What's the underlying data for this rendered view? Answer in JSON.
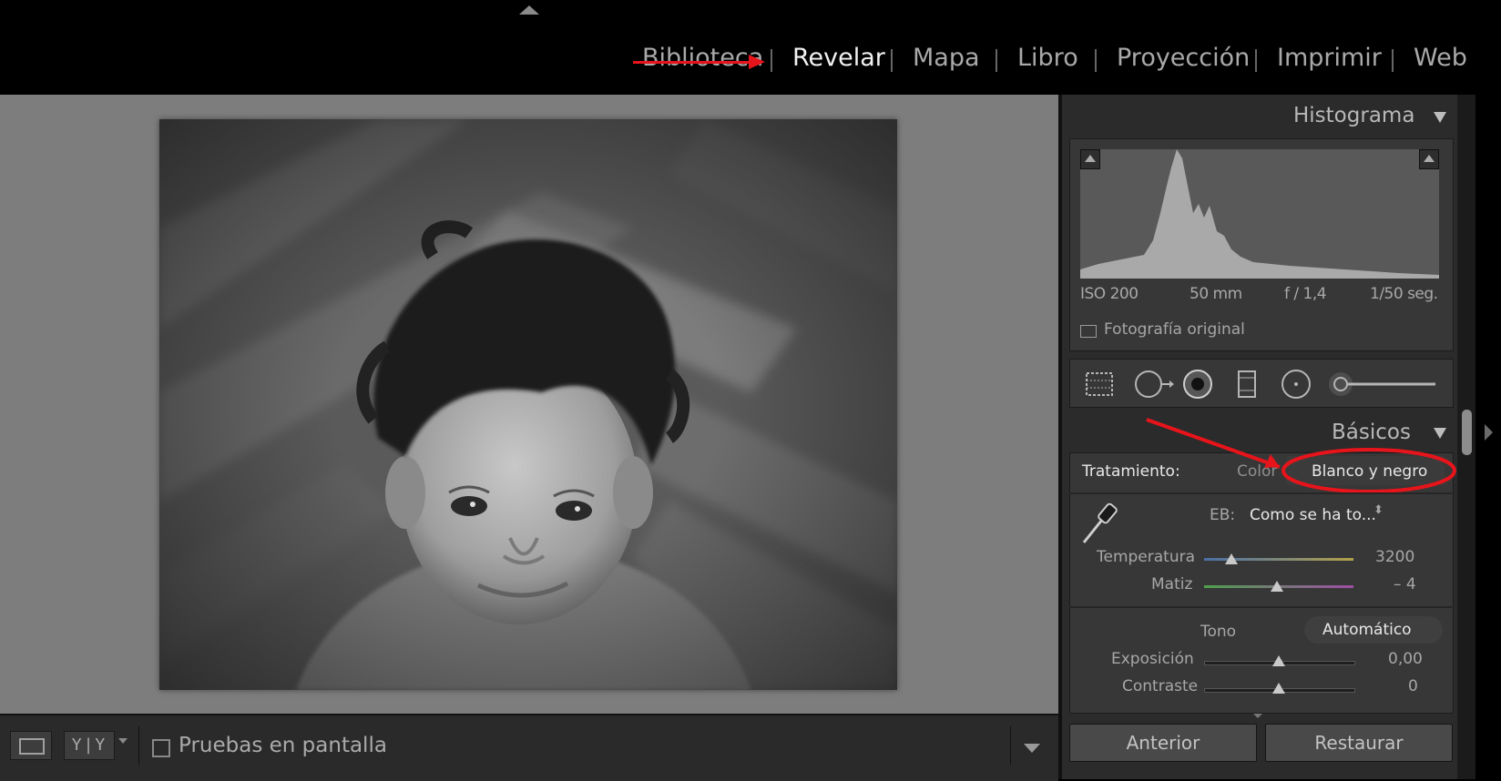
{
  "modules": [
    {
      "label": "Biblioteca",
      "active": false,
      "struck": true
    },
    {
      "label": "Revelar",
      "active": true,
      "struck": false
    },
    {
      "label": "Mapa",
      "active": false,
      "struck": false
    },
    {
      "label": "Libro",
      "active": false,
      "struck": false
    },
    {
      "label": "Proyección",
      "active": false,
      "struck": false
    },
    {
      "label": "Imprimir",
      "active": false,
      "struck": false
    },
    {
      "label": "Web",
      "active": false,
      "struck": false
    }
  ],
  "toolbar": {
    "view_mode_icon": "loupe-view-icon",
    "compare_label": "Y|Y",
    "soft_proof_label": "Pruebas en pantalla",
    "soft_proof_checked": false
  },
  "histogram_panel": {
    "title": "Histograma",
    "exif": {
      "iso": "ISO 200",
      "focal": "50 mm",
      "aperture": "f / 1,4",
      "shutter": "1/50 seg."
    },
    "original_photo_label": "Fotografía original",
    "original_photo_checked": false
  },
  "tools": [
    "crop-icon",
    "spot-removal-icon",
    "red-eye-icon",
    "graduated-filter-icon",
    "radial-filter-icon",
    "adjustment-brush-icon"
  ],
  "basic_panel": {
    "title": "Básicos",
    "treatment_label": "Tratamiento:",
    "treatment_color": "Color",
    "treatment_bw": "Blanco y negro",
    "wb_label": "EB:",
    "wb_value": "Como se ha to...",
    "temperature": {
      "label": "Temperatura",
      "value": "3200",
      "level": 0.18
    },
    "tint": {
      "label": "Matiz",
      "value": "– 4",
      "level": 0.49
    },
    "tone_label": "Tono",
    "auto_label": "Automático",
    "exposure": {
      "label": "Exposición",
      "value": "0,00",
      "level": 0.5
    },
    "contrast": {
      "label": "Contraste",
      "value": "0",
      "level": 0.5
    }
  },
  "buttons": {
    "previous": "Anterior",
    "reset": "Restaurar"
  },
  "annotation_color": "#e8141b"
}
